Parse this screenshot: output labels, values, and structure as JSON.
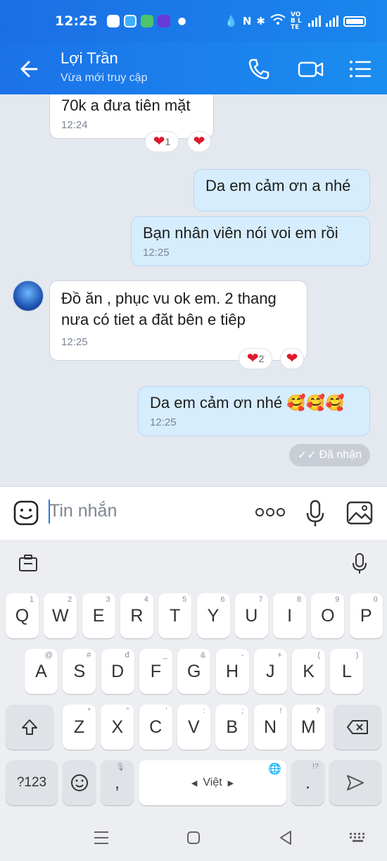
{
  "status_bar": {
    "time": "12:25",
    "network_label": "VOB LTE"
  },
  "header": {
    "contact_name": "Lợi Trần",
    "contact_status": "Vừa mới truy cập"
  },
  "messages": [
    {
      "text": "70k a đưa tiên mặt",
      "time": "12:24",
      "direction": "in",
      "reaction_count": "1"
    },
    {
      "text": "Da em cảm ơn a nhé",
      "time": "",
      "direction": "out"
    },
    {
      "text": "Bạn nhân viên nói voi em rồi",
      "time": "12:25",
      "direction": "out"
    },
    {
      "text_line1": "Đồ ăn , phục vu ok em. 2 thang",
      "text_line2": "nưa có tiet a đăt bên e tiêp",
      "time": "12:25",
      "direction": "in",
      "reaction_count": "2"
    },
    {
      "text": "Da em cảm ơn nhé 🥰🥰🥰",
      "time": "12:25",
      "direction": "out"
    }
  ],
  "received_status": "Đã nhận",
  "input": {
    "placeholder": "Tin nhắn"
  },
  "keyboard": {
    "row1": [
      {
        "key": "Q",
        "hint": "1"
      },
      {
        "key": "W",
        "hint": "2"
      },
      {
        "key": "E",
        "hint": "3"
      },
      {
        "key": "R",
        "hint": "4"
      },
      {
        "key": "T",
        "hint": "5"
      },
      {
        "key": "Y",
        "hint": "6"
      },
      {
        "key": "U",
        "hint": "7"
      },
      {
        "key": "I",
        "hint": "8"
      },
      {
        "key": "O",
        "hint": "9"
      },
      {
        "key": "P",
        "hint": "0"
      }
    ],
    "row2": [
      {
        "key": "A",
        "hint": "@"
      },
      {
        "key": "S",
        "hint": "#"
      },
      {
        "key": "D",
        "hint": "đ"
      },
      {
        "key": "F",
        "hint": "_"
      },
      {
        "key": "G",
        "hint": "&"
      },
      {
        "key": "H",
        "hint": "-"
      },
      {
        "key": "J",
        "hint": "+"
      },
      {
        "key": "K",
        "hint": "("
      },
      {
        "key": "L",
        "hint": ")"
      }
    ],
    "row3": [
      {
        "key": "Z",
        "hint": "*"
      },
      {
        "key": "X",
        "hint": "\""
      },
      {
        "key": "C",
        "hint": "'"
      },
      {
        "key": "V",
        "hint": ":"
      },
      {
        "key": "B",
        "hint": ";"
      },
      {
        "key": "N",
        "hint": "!"
      },
      {
        "key": "M",
        "hint": "?"
      }
    ],
    "numbers_key": "?123",
    "comma_key": ",",
    "space_label": "Việt",
    "period_key": ".",
    "period_hint": "!?"
  },
  "colors": {
    "header_blue": "#1b7fe9",
    "outgoing_bubble": "#d6edfd",
    "heart": "#e0182d"
  }
}
